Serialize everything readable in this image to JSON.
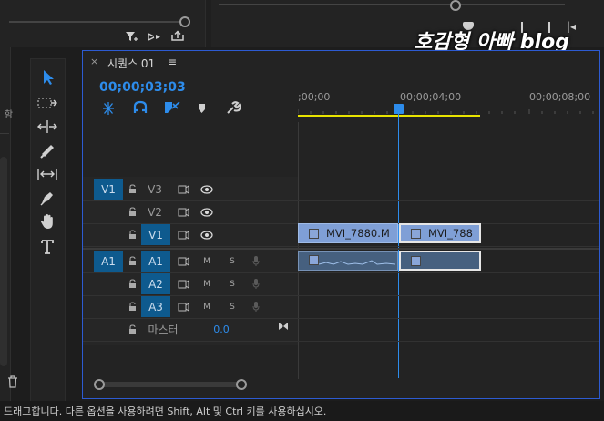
{
  "watermark": "호감형 아빠 blog",
  "sequence": {
    "tab_title": "시퀀스 01",
    "close_glyph": "×",
    "menu_glyph": "≡",
    "timecode": "00;00;03;03"
  },
  "ruler": {
    "ticks": [
      ";00;00",
      "00;00;04;00",
      "00;00;08;00"
    ]
  },
  "video_tracks": [
    {
      "source": "V1",
      "name": "V3"
    },
    {
      "source": "",
      "name": "V2"
    },
    {
      "source": "",
      "name": "V1"
    }
  ],
  "audio_tracks": [
    {
      "source": "A1",
      "name": "A1",
      "mute": "M",
      "solo": "S"
    },
    {
      "source": "",
      "name": "A2",
      "mute": "M",
      "solo": "S"
    },
    {
      "source": "",
      "name": "A3",
      "mute": "M",
      "solo": "S"
    }
  ],
  "master": {
    "label": "마스터",
    "value": "0.0"
  },
  "clips": {
    "video_1": "MVI_7880.M",
    "video_2": "MVI_788"
  },
  "status_bar": "드래그합니다. 다른 옵션을 사용하려면 Shift, Alt 및 Ctrl 키를 사용하십시오.",
  "left_edge_label": "함",
  "icons": {
    "track_video": "film-icon",
    "eye": "eye-icon",
    "lock": "lock-icon",
    "mic": "mic-icon"
  },
  "colors": {
    "accent_blue": "#2d8ceb",
    "target_blue": "#0e5a8e",
    "work_area": "#e8e300",
    "clip_video": "#7f9fd6",
    "clip_audio": "#46607f"
  }
}
